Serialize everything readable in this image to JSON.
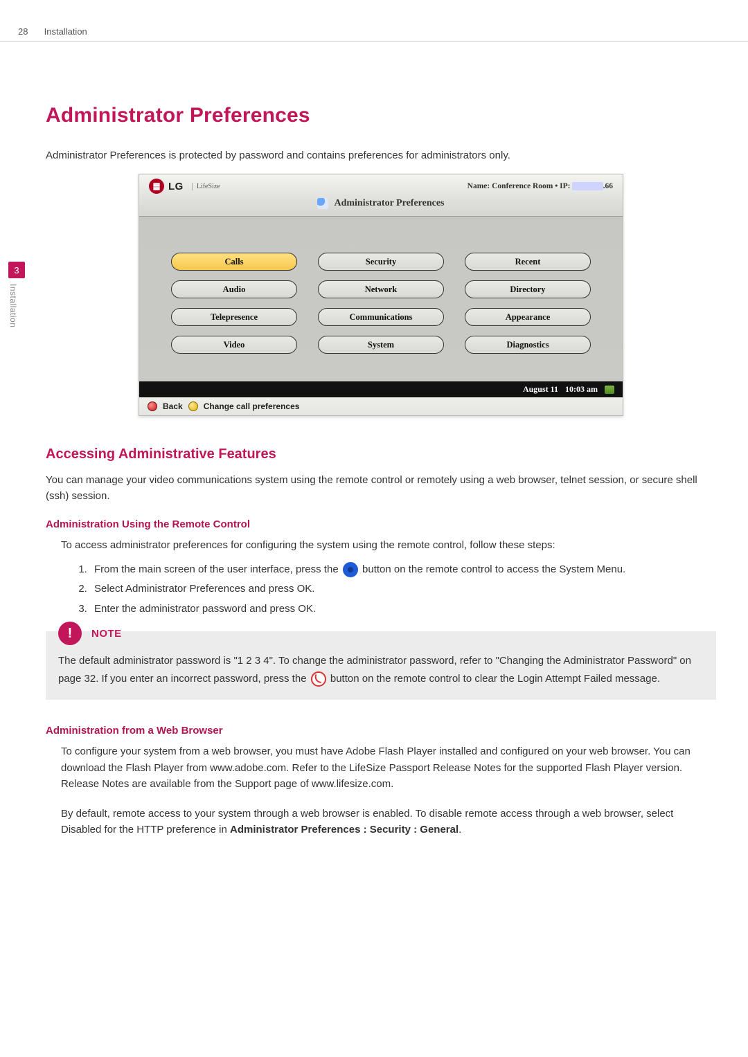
{
  "page": {
    "number": "28",
    "section": "Installation"
  },
  "sidetab": {
    "num": "3",
    "label": "Installation"
  },
  "title": "Administrator Preferences",
  "lead": "Administrator Preferences is protected by password and contains preferences for administrators only.",
  "shot": {
    "brand_lg": "LG",
    "brand_lifesize": "LifeSize",
    "name_label": "Name: Conference Room",
    "ip_label": "IP:",
    "ip_suffix": ".66",
    "window_title": "Administrator Preferences",
    "buttons": [
      {
        "label": "Calls",
        "selected": true
      },
      {
        "label": "Security"
      },
      {
        "label": "Recent"
      },
      {
        "label": "Audio"
      },
      {
        "label": "Network"
      },
      {
        "label": "Directory"
      },
      {
        "label": "Telepresence"
      },
      {
        "label": "Communications"
      },
      {
        "label": "Appearance"
      },
      {
        "label": "Video"
      },
      {
        "label": "System"
      },
      {
        "label": "Diagnostics"
      }
    ],
    "status_date": "August 11",
    "status_time": "10:03 am",
    "foot_back": "Back",
    "foot_change": "Change call preferences"
  },
  "sub_heading": "Accessing Administrative Features",
  "sub_body": "You can manage your video communications system using the remote control or remotely using a web browser, telnet session, or secure shell (ssh) session.",
  "remote_h": "Administration Using the Remote Control",
  "remote_intro": "To access administrator preferences for configuring the system using the remote control, follow these steps:",
  "steps": {
    "s1a": "From the main screen of the user interface, press the ",
    "s1b": " button on the remote control to access the System Menu.",
    "s2": "Select Administrator Preferences and press OK.",
    "s3": "Enter the administrator password and press OK."
  },
  "note": {
    "label": "NOTE",
    "a": "The default administrator password is \"1 2 3 4\".  To change the administrator password, refer to \"Changing the Administrator Password\" on page 32. If you enter an incorrect password, press the ",
    "b": " button on the remote control to clear the Login Attempt Failed message."
  },
  "web_h": "Administration from a Web Browser",
  "web_p1": "To configure your system from a web browser, you must have Adobe Flash Player installed and configured on your web browser. You can download the Flash Player from www.adobe.com. Refer to the LifeSize Passport Release Notes for the supported Flash Player version. Release Notes are available from the Support page of www.lifesize.com.",
  "web_p2a": "By default, remote access to your system through a web browser is enabled. To disable remote access through a web browser, select Disabled for the HTTP preference in ",
  "web_p2b": "Administrator Preferences : Security : General",
  "period": "."
}
